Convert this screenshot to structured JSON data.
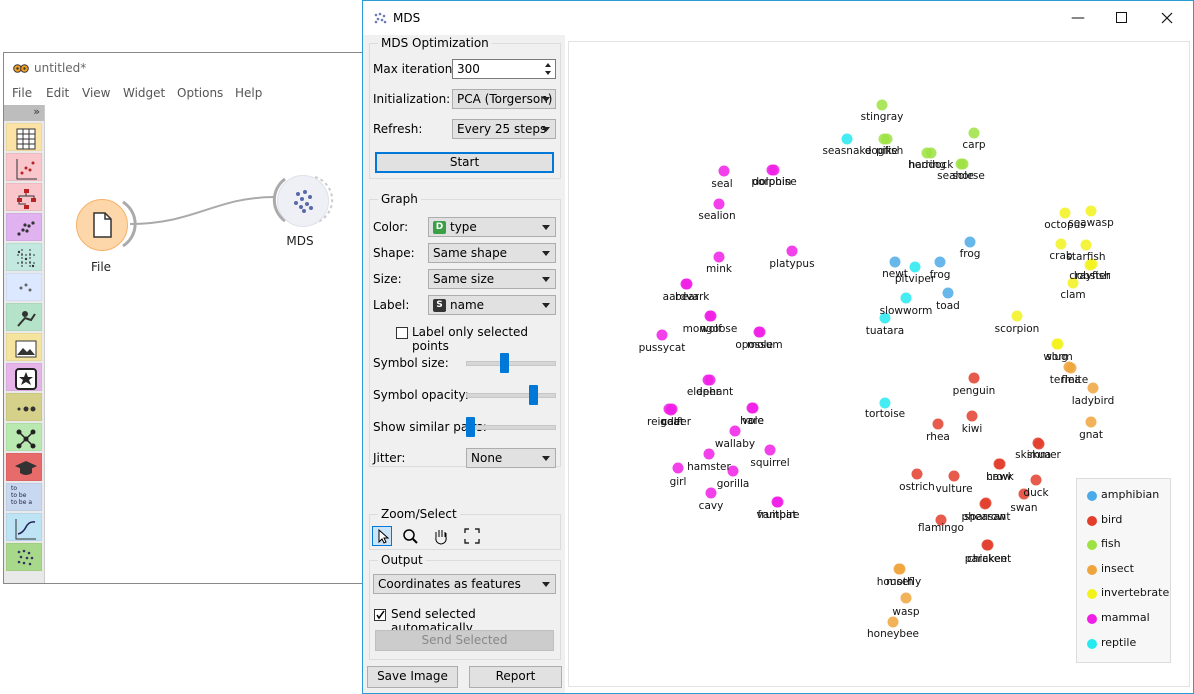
{
  "back_window": {
    "title": "untitled*",
    "menu": [
      "File",
      "Edit",
      "View",
      "Widget",
      "Options",
      "Help"
    ],
    "toolbox_collapse": "»",
    "nodes": [
      {
        "label": "File"
      },
      {
        "label": "MDS"
      }
    ],
    "categories": [
      {
        "icon": "table-icon",
        "color": "#fbe3a6"
      },
      {
        "icon": "scatter-icon",
        "color": "#f9c6cc"
      },
      {
        "icon": "tree-icon",
        "color": "#f9c6cc"
      },
      {
        "icon": "scatter-dots-icon",
        "color": "#e0b3f0"
      },
      {
        "icon": "grid-icon",
        "color": "#c2e8e0"
      },
      {
        "icon": "sparkle-icon",
        "color": "#dbe8ff"
      },
      {
        "icon": "explore-icon",
        "color": "#b5e3c9"
      },
      {
        "icon": "image-icon",
        "color": "#f5e4a0"
      },
      {
        "icon": "star-icon",
        "color": "#e5b5ea"
      },
      {
        "icon": "dots-icon",
        "color": "#d6d18a"
      },
      {
        "icon": "network-icon",
        "color": "#b9e8b0"
      },
      {
        "icon": "education-icon",
        "color": "#e86b6b"
      },
      {
        "icon": "text-icon",
        "color": "#c8d8f0"
      },
      {
        "icon": "timeseries-icon",
        "color": "#bde3f5"
      },
      {
        "icon": "spots-icon",
        "color": "#a8d98a"
      }
    ],
    "category_texts": {
      "text_widget": "to\nto be\nto be a"
    }
  },
  "mds_window": {
    "title": "MDS",
    "controls": {
      "optimization": {
        "title": "MDS Optimization",
        "max_iterations_label": "Max iterations:",
        "max_iterations_value": "300",
        "initialization_label": "Initialization:",
        "initialization_value": "PCA (Torgerson)",
        "refresh_label": "Refresh:",
        "refresh_value": "Every 25 steps",
        "start_label": "Start"
      },
      "graph": {
        "title": "Graph",
        "color_label": "Color:",
        "color_value": "type",
        "color_badge": "D",
        "shape_label": "Shape:",
        "shape_value": "Same shape",
        "size_label": "Size:",
        "size_value": "Same size",
        "label_label": "Label:",
        "label_value": "name",
        "label_badge": "S",
        "label_only_selected": "Label only selected points",
        "symbol_size_label": "Symbol size:",
        "symbol_size_level": 0.43,
        "symbol_opacity_label": "Symbol opacity:",
        "symbol_opacity_level": 0.8,
        "show_similar_label": "Show similar pairs:",
        "show_similar_level": 0.0,
        "jitter_label": "Jitter:",
        "jitter_value": "None"
      },
      "zoom": {
        "title": "Zoom/Select"
      },
      "output": {
        "title": "Output",
        "output_value": "Coordinates as features",
        "send_auto_label": "Send selected automatically",
        "send_selected_label": "Send Selected"
      },
      "save_image_label": "Save Image",
      "report_label": "Report"
    },
    "legend": [
      {
        "label": "amphibian",
        "color": "#4daae8"
      },
      {
        "label": "bird",
        "color": "#e23e2b"
      },
      {
        "label": "fish",
        "color": "#9de242"
      },
      {
        "label": "insect",
        "color": "#f0a53c"
      },
      {
        "label": "invertebrate",
        "color": "#f2f21c"
      },
      {
        "label": "mammal",
        "color": "#f01ee6"
      },
      {
        "label": "reptile",
        "color": "#25eaf0"
      }
    ],
    "points": [
      {
        "label": "stingray",
        "type": "fish"
      },
      {
        "label": "carp",
        "type": "fish"
      },
      {
        "label": "seasnake",
        "type": "reptile"
      },
      {
        "label": "dogfish",
        "type": "fish"
      },
      {
        "label": "pike",
        "type": "fish"
      },
      {
        "label": "haddock",
        "type": "fish"
      },
      {
        "label": "herring",
        "type": "fish"
      },
      {
        "label": "seahorse",
        "type": "fish"
      },
      {
        "label": "sole",
        "type": "fish"
      },
      {
        "label": "seal",
        "type": "mammal"
      },
      {
        "label": "dolphin",
        "type": "mammal"
      },
      {
        "label": "porpoise",
        "type": "mammal"
      },
      {
        "label": "sealion",
        "type": "mammal"
      },
      {
        "label": "octopus",
        "type": "invertebrate"
      },
      {
        "label": "seawasp",
        "type": "invertebrate"
      },
      {
        "label": "crab",
        "type": "invertebrate"
      },
      {
        "label": "starfish",
        "type": "invertebrate"
      },
      {
        "label": "crayfish",
        "type": "invertebrate"
      },
      {
        "label": "lobster",
        "type": "invertebrate"
      },
      {
        "label": "clam",
        "type": "invertebrate"
      },
      {
        "label": "frog",
        "type": "amphibian"
      },
      {
        "label": "newt",
        "type": "amphibian"
      },
      {
        "label": "pitviper",
        "type": "reptile"
      },
      {
        "label": "frog",
        "type": "amphibian"
      },
      {
        "label": "toad",
        "type": "amphibian"
      },
      {
        "label": "mink",
        "type": "mammal"
      },
      {
        "label": "platypus",
        "type": "mammal"
      },
      {
        "label": "aardvark",
        "type": "mammal"
      },
      {
        "label": "bear",
        "type": "mammal"
      },
      {
        "label": "slowworm",
        "type": "reptile"
      },
      {
        "label": "tuatara",
        "type": "reptile"
      },
      {
        "label": "scorpion",
        "type": "invertebrate"
      },
      {
        "label": "mongoose",
        "type": "mammal"
      },
      {
        "label": "wolf",
        "type": "mammal"
      },
      {
        "label": "pussycat",
        "type": "mammal"
      },
      {
        "label": "opossum",
        "type": "mammal"
      },
      {
        "label": "mole",
        "type": "mammal"
      },
      {
        "label": "slug",
        "type": "invertebrate"
      },
      {
        "label": "worm",
        "type": "invertebrate"
      },
      {
        "label": "termite",
        "type": "insect"
      },
      {
        "label": "flea",
        "type": "insect"
      },
      {
        "label": "penguin",
        "type": "bird"
      },
      {
        "label": "ladybird",
        "type": "insect"
      },
      {
        "label": "deer",
        "type": "mammal"
      },
      {
        "label": "elephant",
        "type": "mammal"
      },
      {
        "label": "reindeer",
        "type": "mammal"
      },
      {
        "label": "goat",
        "type": "mammal"
      },
      {
        "label": "calf",
        "type": "mammal"
      },
      {
        "label": "hare",
        "type": "mammal"
      },
      {
        "label": "vole",
        "type": "mammal"
      },
      {
        "label": "tortoise",
        "type": "reptile"
      },
      {
        "label": "rhea",
        "type": "bird"
      },
      {
        "label": "kiwi",
        "type": "bird"
      },
      {
        "label": "gnat",
        "type": "insect"
      },
      {
        "label": "wallaby",
        "type": "mammal"
      },
      {
        "label": "squirrel",
        "type": "mammal"
      },
      {
        "label": "hamster",
        "type": "mammal"
      },
      {
        "label": "skimmer",
        "type": "bird"
      },
      {
        "label": "skua",
        "type": "bird"
      },
      {
        "label": "girl",
        "type": "mammal"
      },
      {
        "label": "gorilla",
        "type": "mammal"
      },
      {
        "label": "hawk",
        "type": "bird"
      },
      {
        "label": "crow",
        "type": "bird"
      },
      {
        "label": "ostrich",
        "type": "bird"
      },
      {
        "label": "vulture",
        "type": "bird"
      },
      {
        "label": "duck",
        "type": "bird"
      },
      {
        "label": "cavy",
        "type": "mammal"
      },
      {
        "label": "fruitbat",
        "type": "mammal"
      },
      {
        "label": "vampire",
        "type": "mammal"
      },
      {
        "label": "swan",
        "type": "bird"
      },
      {
        "label": "pheasant",
        "type": "bird"
      },
      {
        "label": "sparrow",
        "type": "bird"
      },
      {
        "label": "flamingo",
        "type": "bird"
      },
      {
        "label": "parakeet",
        "type": "bird"
      },
      {
        "label": "chicken",
        "type": "bird"
      },
      {
        "label": "housefly",
        "type": "insect"
      },
      {
        "label": "moth",
        "type": "insect"
      },
      {
        "label": "wasp",
        "type": "insect"
      },
      {
        "label": "honeybee",
        "type": "insect"
      }
    ]
  }
}
